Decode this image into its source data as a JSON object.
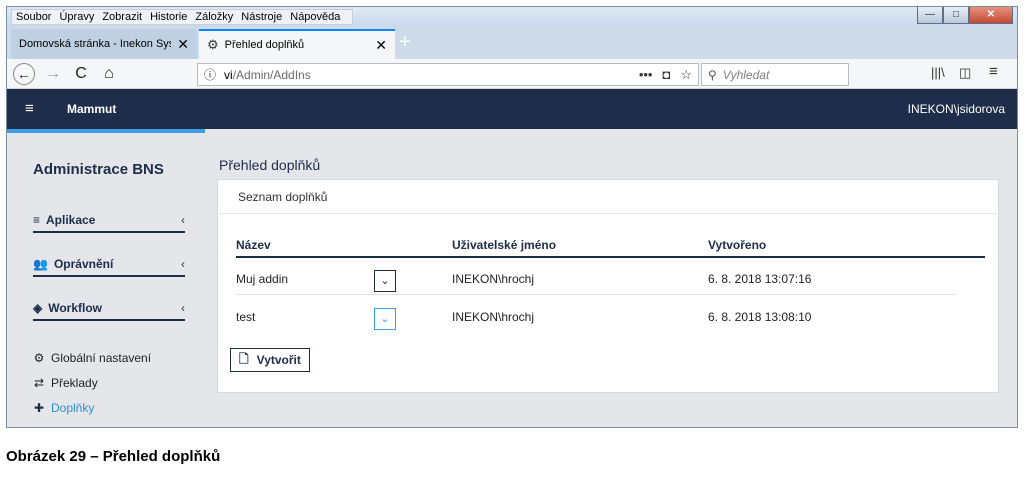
{
  "menu": [
    "Soubor",
    "Úpravy",
    "Zobrazit",
    "Historie",
    "Záložky",
    "Nástroje",
    "Nápověda"
  ],
  "window_controls": {
    "minimize": "—",
    "maximize": "□",
    "close": "✕"
  },
  "tabs": [
    {
      "label": "Domovská stránka - Inekon Systems",
      "close": "✕"
    },
    {
      "label": "Přehled doplňků",
      "close": "✕"
    }
  ],
  "new_tab": "+",
  "nav": {
    "back": "←",
    "forward": "→",
    "reload": "C",
    "home": "⌂"
  },
  "url": {
    "host": "vi",
    "path": "/Admin/AddIns",
    "info": "ⓘ",
    "more": "•••",
    "pocket": "◘",
    "star": "☆"
  },
  "search": {
    "placeholder": "Vyhledat",
    "icon": "⚲"
  },
  "toolbar_icons": {
    "library": "|||\\",
    "sidebar": "◫",
    "menu": "≡"
  },
  "app": {
    "menu_icon": "≡",
    "title": "Mammut",
    "user": "INEKON\\jsidorova"
  },
  "sidebar": {
    "title": "Administrace BNS",
    "groups": [
      {
        "icon": "≡",
        "label": "Aplikace",
        "chevron": "‹"
      },
      {
        "icon": "👥",
        "label": "Oprávnění",
        "chevron": "‹"
      },
      {
        "icon": "◈",
        "label": "Workflow",
        "chevron": "‹"
      }
    ],
    "links": [
      {
        "icon": "⚙",
        "label": "Globální nastavení"
      },
      {
        "icon": "⇄",
        "label": "Překlady"
      },
      {
        "icon": "✚",
        "label": "Doplňky"
      }
    ]
  },
  "main": {
    "title": "Přehled doplňků",
    "card_title": "Seznam doplňků",
    "columns": [
      "Název",
      "Uživatelské jméno",
      "Vytvořeno"
    ],
    "rows": [
      {
        "name": "Muj addin",
        "user": "INEKON\\hrochj",
        "created": "6. 8. 2018 13:07:16",
        "chevron": "⌄"
      },
      {
        "name": "test",
        "user": "INEKON\\hrochj",
        "created": "6. 8. 2018 13:08:10",
        "chevron": "⌄"
      }
    ],
    "create_label": "Vytvořit",
    "create_icon": "🗋"
  },
  "caption": "Obrázek 29 – Přehled doplňků",
  "colors": {
    "header": "#1e2d4a",
    "accent": "#3a9ee0",
    "background": "#e4e6ea"
  }
}
